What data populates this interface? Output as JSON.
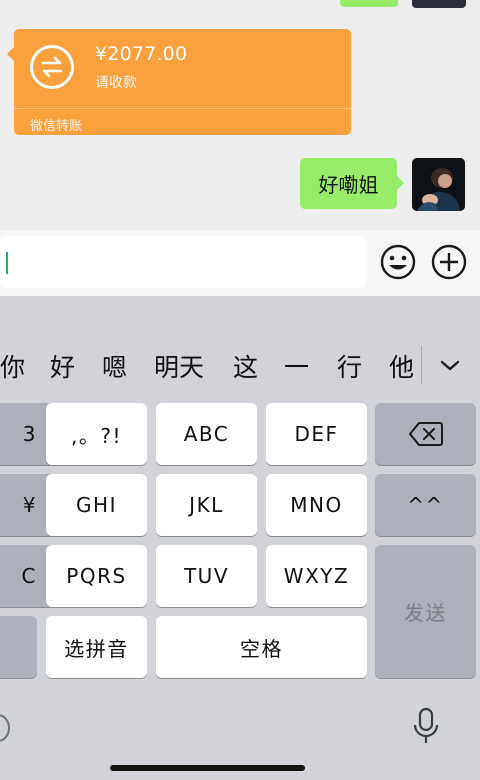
{
  "chat": {
    "transfer": {
      "amount": "¥2077.00",
      "note": "请收款",
      "footer": "微信转账",
      "color": "#f9a03f"
    },
    "message": {
      "text": "好嘞姐",
      "bubble_color": "#95ec69"
    }
  },
  "input_bar": {
    "emoji_icon": "smiley-face-icon",
    "add_icon": "plus-circle-icon"
  },
  "keyboard": {
    "candidates": [
      "你",
      "好",
      "嗯",
      "明天",
      "这",
      "一",
      "行",
      "他"
    ],
    "expand_icon": "chevron-down-icon",
    "keys": {
      "left_row1": "3",
      "left_row2": "¥",
      "left_row3": "C",
      "punct": ",。?!",
      "abc": "ABC",
      "def": "DEF",
      "ghi": "GHI",
      "jkl": "JKL",
      "mno": "MNO",
      "pqrs": "PQRS",
      "tuv": "TUV",
      "wxyz": "WXYZ",
      "face": "^^",
      "send": "发送",
      "pinyin": "选拼音",
      "space": "空格"
    },
    "backspace_icon": "backspace-icon",
    "mic_icon": "microphone-icon"
  }
}
